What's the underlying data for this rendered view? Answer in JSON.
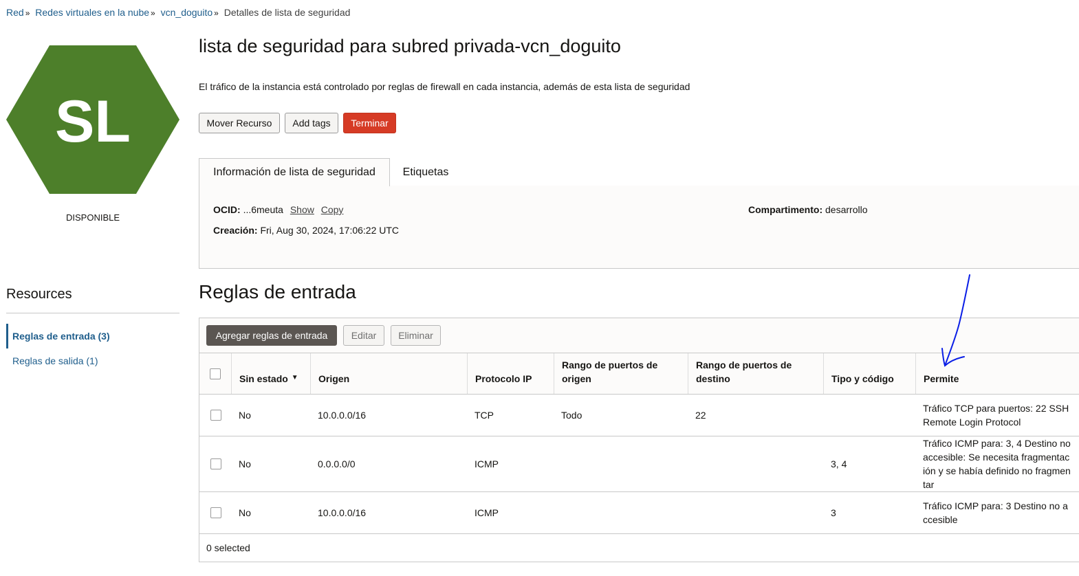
{
  "breadcrumb": [
    {
      "label": "Red"
    },
    {
      "label": "Redes virtuales en la nube"
    },
    {
      "label": "vcn_doguito"
    },
    {
      "label": "Detalles de lista de seguridad"
    }
  ],
  "resource_icon": {
    "initials": "SL",
    "status": "DISPONIBLE",
    "color": "#4d7f2a",
    "icon": "hexagon-icon"
  },
  "page": {
    "title": "lista de seguridad para subred privada-vcn_doguito",
    "description": "El tráfico de la instancia está controlado por reglas de firewall en cada instancia, además de esta lista de seguridad"
  },
  "actions": {
    "move": "Mover Recurso",
    "tags": "Add tags",
    "terminate": "Terminar"
  },
  "tabs": [
    {
      "label": "Información de lista de seguridad",
      "active": true
    },
    {
      "label": "Etiquetas",
      "active": false
    }
  ],
  "info": {
    "ocid_label": "OCID:",
    "ocid_value": "...6meuta",
    "show": "Show",
    "copy": "Copy",
    "created_label": "Creación:",
    "created_value": "Fri, Aug 30, 2024, 17:06:22 UTC",
    "compartment_label": "Compartimento:",
    "compartment_value": "desarrollo"
  },
  "resources": {
    "title": "Resources",
    "items": [
      {
        "label": "Reglas de entrada (3)",
        "active": true
      },
      {
        "label": "Reglas de salida (1)",
        "active": false
      }
    ]
  },
  "ingress": {
    "title": "Reglas de entrada",
    "add": "Agregar reglas de entrada",
    "edit": "Editar",
    "delete": "Eliminar",
    "columns": [
      "Sin estado",
      "Origen",
      "Protocolo IP",
      "Rango de puertos de origen",
      "Rango de puertos de destino",
      "Tipo y código",
      "Permite"
    ],
    "rows": [
      {
        "stateless": "No",
        "source": "10.0.0.0/16",
        "protocol": "TCP",
        "src_ports": "Todo",
        "dst_ports": "22",
        "type_code": "",
        "allows": "Tráfico TCP para puertos: 22 SSH Remote Login Protocol"
      },
      {
        "stateless": "No",
        "source": "0.0.0.0/0",
        "protocol": "ICMP",
        "src_ports": "",
        "dst_ports": "",
        "type_code": "3, 4",
        "allows": "Tráfico ICMP para: 3, 4 Destino no accesible: Se necesita fragmentación y se había definido no fragmentar"
      },
      {
        "stateless": "No",
        "source": "10.0.0.0/16",
        "protocol": "ICMP",
        "src_ports": "",
        "dst_ports": "",
        "type_code": "3",
        "allows": "Tráfico ICMP para: 3 Destino no accesible"
      }
    ],
    "selected": "0 selected"
  },
  "colors": {
    "link": "#1f5e8c",
    "danger": "#d63b25",
    "primary_button": "#5b5652",
    "annotation": "#0a1ee6"
  }
}
